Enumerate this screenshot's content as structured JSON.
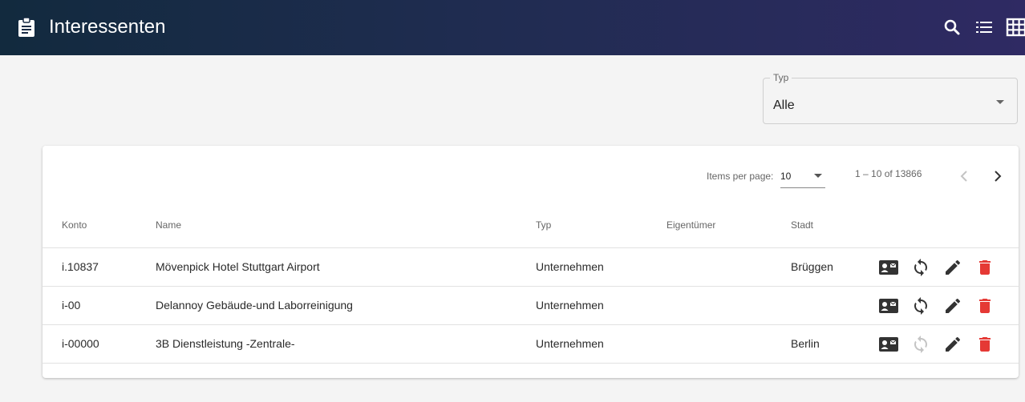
{
  "header": {
    "title": "Interessenten",
    "icons": [
      "clipboard-icon",
      "search-icon",
      "list-view-icon",
      "grid-view-icon"
    ]
  },
  "filter": {
    "label": "Typ",
    "value": "Alle"
  },
  "pagination": {
    "items_per_page_label": "Items per page:",
    "items_per_page": "10",
    "range": "1 – 10 of 13866"
  },
  "table": {
    "headers": {
      "konto": "Konto",
      "name": "Name",
      "typ": "Typ",
      "eigentuemer": "Eigentümer",
      "stadt": "Stadt"
    },
    "rows": [
      {
        "konto": "i.10837",
        "name": "Mövenpick Hotel Stuttgart Airport",
        "typ": "Unternehmen",
        "eigentuemer": "",
        "stadt": "Brüggen"
      },
      {
        "konto": "i-00",
        "name": "Delannoy Gebäude-und Laborreinigung",
        "typ": "Unternehmen",
        "eigentuemer": "",
        "stadt": ""
      },
      {
        "konto": "i-00000",
        "name": "3B Dienstleistung -Zentrale-",
        "typ": "Unternehmen",
        "eigentuemer": "",
        "stadt": "Berlin"
      }
    ],
    "row_action_icons": [
      "contact-card-icon",
      "sync-icon",
      "edit-icon",
      "delete-icon"
    ]
  },
  "colors": {
    "header_gradient_start": "#122a3e",
    "header_gradient_end": "#2f2a63",
    "delete": "#e53935",
    "icon_dark": "#333333",
    "icon_disabled": "#c4c4c4"
  }
}
